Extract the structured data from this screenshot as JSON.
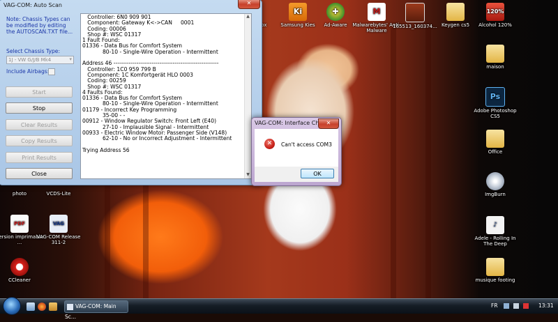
{
  "autoscan": {
    "title": "VAG-COM: Auto Scan",
    "note": "Note:  Chassis Types can be modified by editing the AUTOSCAN.TXT file...",
    "chassis_label": "Select Chassis Type:",
    "chassis_value": "1J - VW G/J/B Mk4",
    "airbags_label": "Include Airbags:",
    "buttons": {
      "start": "Start",
      "stop": "Stop",
      "clear": "Clear Results",
      "copy": "Copy Results",
      "print": "Print Results",
      "close": "Close"
    },
    "log": [
      "   Controller: 6N0 909 901",
      "   Component: Gateway K<->CAN     0001",
      "   Coding: 00006",
      "   Shop #: WSC 01317",
      "1 Fault Found:",
      "01336 - Data Bus for Comfort System",
      "            80-10 - Single-Wire Operation - Intermittent",
      "",
      "Address 46 -------------------------------------------------------",
      "   Controller: 1C0 959 799 B",
      "   Component: 1C Komfortgerät HLO 0003",
      "   Coding: 00259",
      "   Shop #: WSC 01317",
      "4 Faults Found:",
      "01336 - Data Bus for Comfort System",
      "            80-10 - Single-Wire Operation - Intermittent",
      "01179 - Incorrect Key Programming",
      "            35-00 - -",
      "00912 - Window Regulator Switch: Front Left (E40)",
      "            27-10 - Implausible Signal - Intermittent",
      "00933 - Electric Window Motor: Passenger Side (V148)",
      "            62-10 - No or Incorrect Adjustment - Intermittent",
      "",
      "Trying Address 56"
    ]
  },
  "dialog": {
    "title": "VAG-COM: Interface Check",
    "message": "Can't access COM3",
    "ok": "OK"
  },
  "desktop_icons": {
    "firefox": "efox",
    "kies": "Samsung Kies",
    "adaware": "Ad-Aware",
    "malwarebytes": "Malwarebytes' Anti-Malware",
    "image_file": "165513_160374...",
    "keygen": "Keygen cs5",
    "alcohol": "Alcohol 120%",
    "maison": "maison",
    "photoshop": "Adobe Photoshop CS5",
    "office": "Office",
    "imgburn": "ImgBurn",
    "adele": "Adele - Rolling In The Deep",
    "musique": "musique footing",
    "photo": "photo",
    "vcds_lite": "VCDS-Lite",
    "version": "Version imprimable ...",
    "vagcom": "VAG-COM Release 311-2",
    "ccleaner": "CCleaner"
  },
  "taskbar": {
    "task_label": "VAG-COM: Main Sc...",
    "lang": "FR",
    "clock": "13:31"
  },
  "colors": {
    "aero_frame": "#b9d1ea",
    "dialog_frame": "#c9b6d9",
    "error_red": "#c8221a"
  }
}
